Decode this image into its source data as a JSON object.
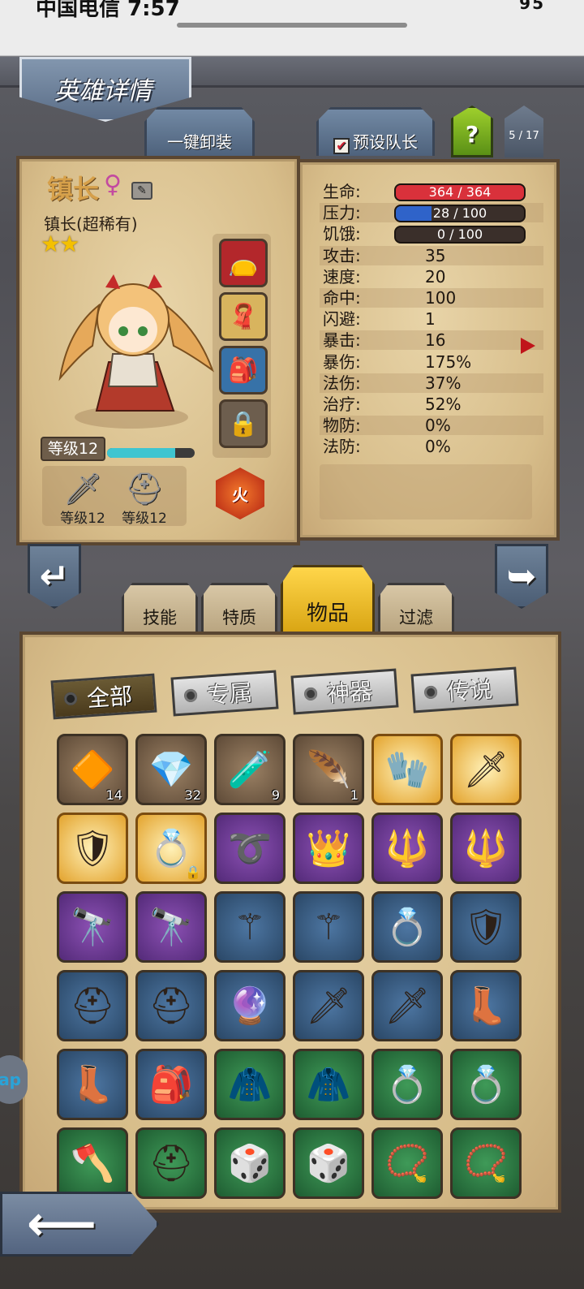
{
  "status_bar": {
    "carrier_time": "中国电信 7:57",
    "battery": "95"
  },
  "header": {
    "title": "英雄详情"
  },
  "top_tabs": {
    "unequip_all": "一键卸装",
    "preset_leader": "预设队长",
    "help": "?",
    "team_count": "5 / 17"
  },
  "hero": {
    "name": "镇长",
    "gender_symbol": "♀",
    "subtitle": "镇长(超稀有)",
    "stars": 2,
    "stars_text": "★★",
    "level_label": "等级12",
    "xp_progress": 0.78,
    "weapon_level": "等级12",
    "armor_level": "等级12",
    "element": "火"
  },
  "stats": [
    {
      "label": "生命:",
      "value": "364 / 364",
      "type": "bar",
      "fill": 1.0,
      "color": "#d9313b"
    },
    {
      "label": "压力:",
      "value": "28 / 100",
      "type": "bar",
      "fill": 0.28,
      "color": "#2f63c9"
    },
    {
      "label": "饥饿:",
      "value": "0 / 100",
      "type": "bar",
      "fill": 0,
      "color": "#3a2f2a"
    },
    {
      "label": "攻击:",
      "value": "35"
    },
    {
      "label": "速度:",
      "value": "20"
    },
    {
      "label": "命中:",
      "value": "100"
    },
    {
      "label": "闪避:",
      "value": "1"
    },
    {
      "label": "暴击:",
      "value": "16"
    },
    {
      "label": "暴伤:",
      "value": "175%"
    },
    {
      "label": "法伤:",
      "value": "37%"
    },
    {
      "label": "治疗:",
      "value": "52%"
    },
    {
      "label": "物防:",
      "value": "0%"
    },
    {
      "label": "法防:",
      "value": "0%"
    }
  ],
  "inventory_tabs": [
    "技能",
    "特质",
    "物品",
    "过滤"
  ],
  "inventory_active_tab": "物品",
  "filters": [
    "全部",
    "专属",
    "神器",
    "传说"
  ],
  "active_filter": "全部",
  "items": [
    {
      "icon": "rune-gem-icon",
      "glyph": "🔶",
      "rarity": "brown",
      "count": "14"
    },
    {
      "icon": "blue-crystal-icon",
      "glyph": "💎",
      "rarity": "brown",
      "count": "32"
    },
    {
      "icon": "potion-icon",
      "glyph": "🧪",
      "rarity": "brown",
      "count": "9"
    },
    {
      "icon": "feather-icon",
      "glyph": "🪶",
      "rarity": "brown",
      "count": "1"
    },
    {
      "icon": "gauntlet-icon",
      "glyph": "🧤",
      "rarity": "gold"
    },
    {
      "icon": "flame-sword-icon",
      "glyph": "🗡",
      "rarity": "gold"
    },
    {
      "icon": "dark-armor-icon",
      "glyph": "🛡",
      "rarity": "gold"
    },
    {
      "icon": "jade-ring-icon",
      "glyph": "💍",
      "rarity": "gold",
      "locked": true
    },
    {
      "icon": "whip-icon",
      "glyph": "➰",
      "rarity": "purple"
    },
    {
      "icon": "tiara-icon",
      "glyph": "👑",
      "rarity": "purple"
    },
    {
      "icon": "ruby-staff-icon",
      "glyph": "🔱",
      "rarity": "purple"
    },
    {
      "icon": "ruby-staff-icon",
      "glyph": "🔱",
      "rarity": "purple"
    },
    {
      "icon": "spyglass-icon",
      "glyph": "🔭",
      "rarity": "purple"
    },
    {
      "icon": "spyglass-icon",
      "glyph": "🔭",
      "rarity": "purple"
    },
    {
      "icon": "winged-staff-icon",
      "glyph": "⚚",
      "rarity": "blue"
    },
    {
      "icon": "winged-staff-icon",
      "glyph": "⚚",
      "rarity": "blue"
    },
    {
      "icon": "amethyst-ring-icon",
      "glyph": "💍",
      "rarity": "blue"
    },
    {
      "icon": "wooden-shield-icon",
      "glyph": "🛡",
      "rarity": "blue"
    },
    {
      "icon": "gold-helmet-icon",
      "glyph": "⛑",
      "rarity": "blue"
    },
    {
      "icon": "gold-helmet-icon",
      "glyph": "⛑",
      "rarity": "blue"
    },
    {
      "icon": "crystal-scepter-icon",
      "glyph": "🔮",
      "rarity": "blue"
    },
    {
      "icon": "long-sword-icon",
      "glyph": "🗡",
      "rarity": "blue"
    },
    {
      "icon": "long-sword-icon",
      "glyph": "🗡",
      "rarity": "blue"
    },
    {
      "icon": "winged-boots-icon",
      "glyph": "👢",
      "rarity": "blue"
    },
    {
      "icon": "winged-boots-icon",
      "glyph": "👢",
      "rarity": "blue"
    },
    {
      "icon": "backpack-icon",
      "glyph": "🎒",
      "rarity": "blue"
    },
    {
      "icon": "mage-robe-icon",
      "glyph": "🧥",
      "rarity": "green"
    },
    {
      "icon": "mage-robe-icon",
      "glyph": "🧥",
      "rarity": "green"
    },
    {
      "icon": "emerald-ring-icon",
      "glyph": "💍",
      "rarity": "green"
    },
    {
      "icon": "emerald-ring-icon",
      "glyph": "💍",
      "rarity": "green"
    },
    {
      "icon": "war-axe-icon",
      "glyph": "🪓",
      "rarity": "green"
    },
    {
      "icon": "iron-helmet-icon",
      "glyph": "⛑",
      "rarity": "green"
    },
    {
      "icon": "dice-icon",
      "glyph": "🎲",
      "rarity": "green"
    },
    {
      "icon": "dice-icon",
      "glyph": "🎲",
      "rarity": "green"
    },
    {
      "icon": "sapphire-necklace-icon",
      "glyph": "📿",
      "rarity": "green"
    },
    {
      "icon": "sapphire-necklace-icon",
      "glyph": "📿",
      "rarity": "green"
    }
  ],
  "side_tab": "ap"
}
